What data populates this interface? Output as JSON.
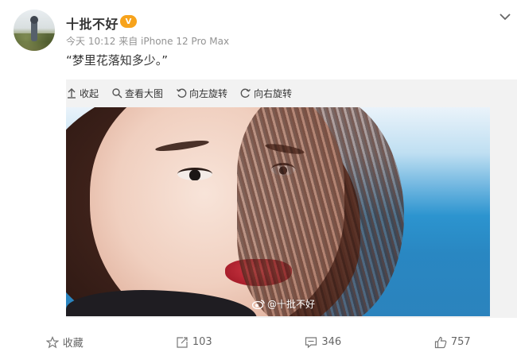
{
  "post": {
    "author": "十批不好",
    "badge": "V",
    "meta": "今天 10:12 来自 iPhone 12 Pro Max",
    "text": "“梦里花落知多少。”"
  },
  "toolbar": {
    "items": [
      {
        "label": "收起",
        "icon": "collapse-icon"
      },
      {
        "label": "查看大图",
        "icon": "zoom-icon"
      },
      {
        "label": "向左旋转",
        "icon": "rotate-left-icon"
      },
      {
        "label": "向右旋转",
        "icon": "rotate-right-icon"
      }
    ]
  },
  "image": {
    "watermark": "@十批不好"
  },
  "actions": {
    "favorite": {
      "label": "收藏",
      "icon": "star-icon"
    },
    "repost": {
      "label": "103",
      "icon": "repost-icon"
    },
    "comment": {
      "label": "346",
      "icon": "comment-icon"
    },
    "like": {
      "label": "757",
      "icon": "thumb-up-icon"
    }
  },
  "colors": {
    "text": "#333333",
    "meta": "#939393",
    "badge": "#f7a31c",
    "panel": "#f2f2f2"
  }
}
